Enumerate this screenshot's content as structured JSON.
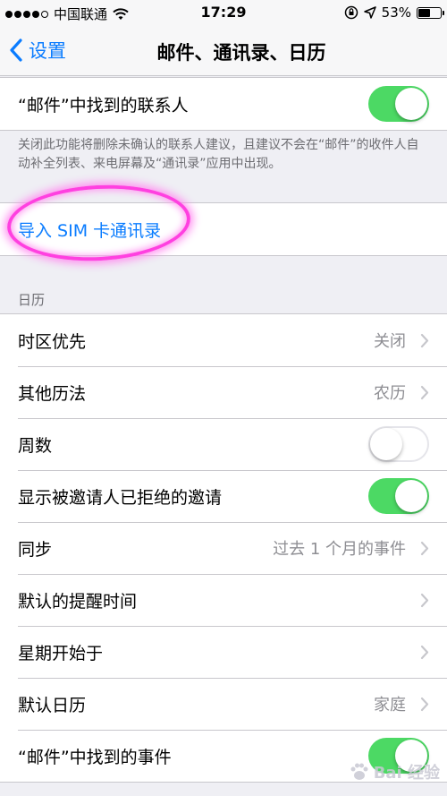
{
  "status_bar": {
    "carrier": "中国联通",
    "time": "17:29",
    "battery": "53%",
    "battery_level": 0.53
  },
  "nav": {
    "back_label": "设置",
    "title": "邮件、通讯录、日历"
  },
  "contacts_group": {
    "found_contacts_label": "“邮件”中找到的联系人",
    "found_contacts_on": true,
    "footer": "关闭此功能将删除未确认的联系人建议，且建议不会在“邮件”的收件人自动补全列表、来电屏幕及“通讯录”应用中出现。"
  },
  "import": {
    "label": "导入 SIM 卡通讯录"
  },
  "calendar_section": {
    "header": "日历",
    "rows": [
      {
        "label": "时区优先",
        "value": "关闭",
        "type": "chevron"
      },
      {
        "label": "其他历法",
        "value": "农历",
        "type": "chevron"
      },
      {
        "label": "周数",
        "type": "toggle",
        "on": false
      },
      {
        "label": "显示被邀请人已拒绝的邀请",
        "type": "toggle",
        "on": true
      },
      {
        "label": "同步",
        "value": "过去 1 个月的事件",
        "type": "chevron"
      },
      {
        "label": "默认的提醒时间",
        "value": "",
        "type": "chevron"
      },
      {
        "label": "星期开始于",
        "value": "",
        "type": "chevron"
      },
      {
        "label": "默认日历",
        "value": "家庭",
        "type": "chevron"
      },
      {
        "label": "“邮件”中找到的事件",
        "type": "toggle",
        "on": true
      }
    ]
  },
  "watermark": {
    "text": "Bai  经验"
  },
  "colors": {
    "accent": "#0a7cff",
    "toggle_on": "#4cd964",
    "background": "#efeff4",
    "highlight": "#ff40e0"
  }
}
